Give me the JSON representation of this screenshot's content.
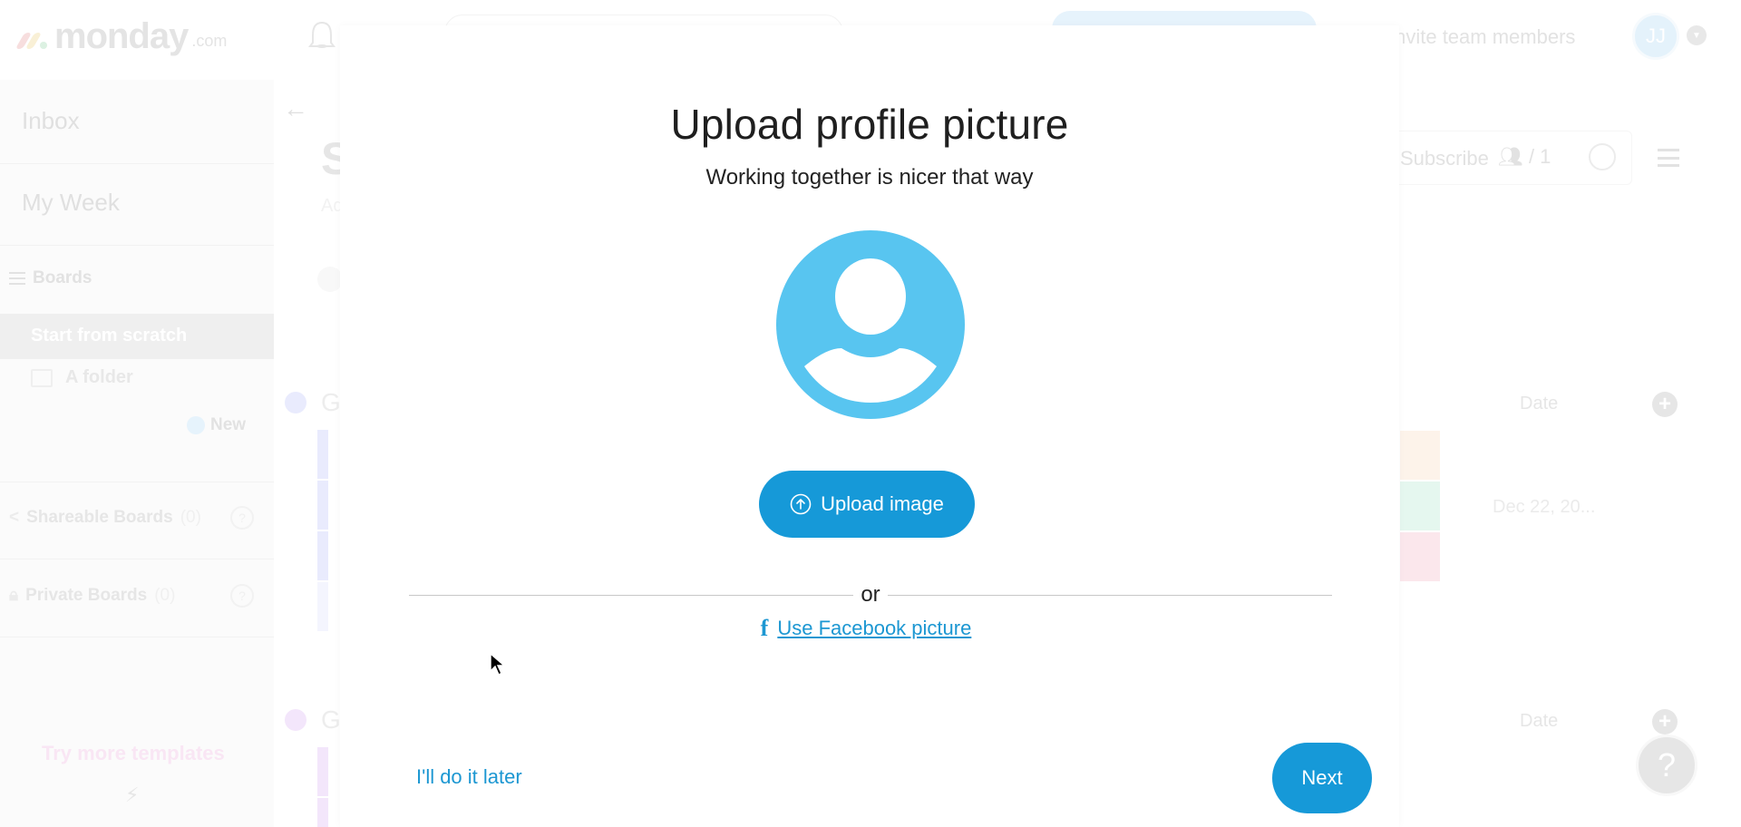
{
  "app": {
    "brand": "monday",
    "brand_suffix": ".com",
    "invite_label": "Invite team members",
    "user_initials": "JJ"
  },
  "sidebar": {
    "inbox": "Inbox",
    "my_week": "My Week",
    "boards_label": "Boards",
    "active_board": "Start from scratch",
    "folder": "A folder",
    "new_label": "New",
    "shareable": {
      "label": "Shareable Boards",
      "count": "(0)"
    },
    "private": {
      "label": "Private Boards",
      "count": "(0)"
    },
    "try_more": "Try more templates"
  },
  "board": {
    "title_initial": "S",
    "desc_initial": "Ad",
    "subscribe": "Subscribe",
    "members": "/ 1",
    "groups": [
      {
        "name_initial": "G",
        "color": "#e9ebfd"
      },
      {
        "name_initial": "G",
        "color": "#f3e6fb"
      }
    ],
    "date_header": "Date",
    "date_value": "Dec 22, 20...",
    "status_colors": [
      "#fdf3ea",
      "#e5f7ef",
      "#fbe7ec"
    ]
  },
  "modal": {
    "title": "Upload profile picture",
    "subtitle": "Working together is nicer that way",
    "upload_button": "Upload image",
    "or": "or",
    "facebook_link": "Use Facebook picture",
    "skip_link": "I'll do it later",
    "next_button": "Next",
    "accent": "#1699d8",
    "avatar_color": "#58c5f0"
  },
  "help_label": "?"
}
